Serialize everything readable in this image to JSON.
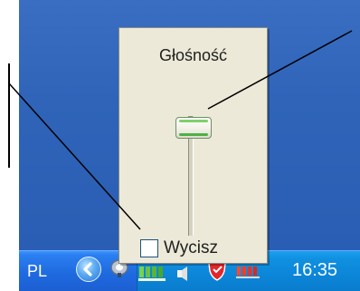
{
  "volume_popup": {
    "title": "Głośność",
    "level": 0.9,
    "mute_label": "Wycisz",
    "mute_checked": false
  },
  "taskbar": {
    "language": "PL",
    "clock": "16:35"
  },
  "tray_icons": [
    "show-hidden-icons-chevron-icon",
    "network-icon",
    "battery-meter-icon",
    "volume-speaker-icon",
    "security-shield-icon",
    "battery-level-icon"
  ],
  "colors": {
    "desktop": "#2f64b9",
    "taskbar": "#1f6ae0",
    "tray": "#0c86d8",
    "popup": "#ece9d8",
    "thumb_green": "#4fb046",
    "callout_line": "#000000"
  }
}
